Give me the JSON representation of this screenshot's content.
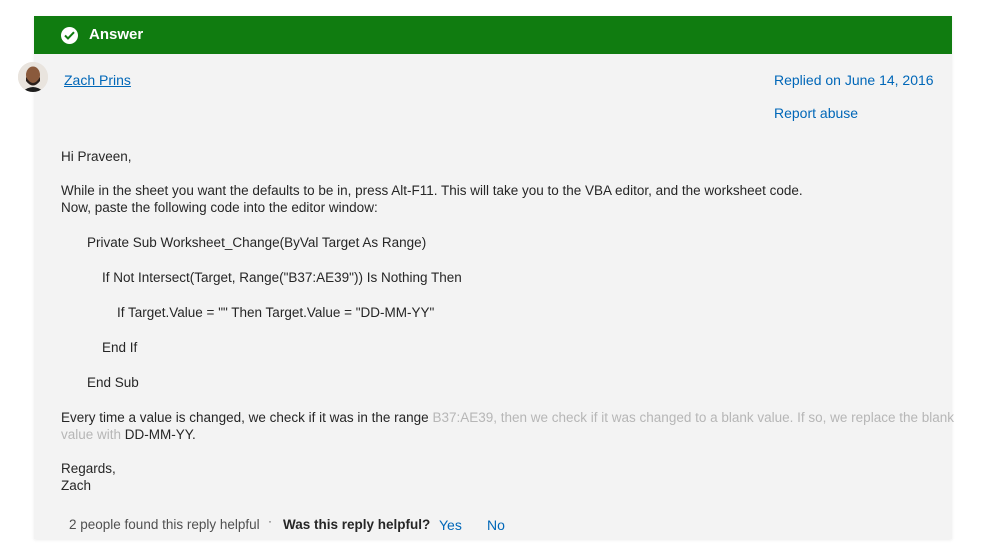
{
  "answer_header": {
    "label": "Answer",
    "icon": "check-circle-icon",
    "color": "#107c10"
  },
  "author": {
    "name": "Zach Prins",
    "avatar": "avatar-icon"
  },
  "meta": {
    "replied": "Replied on June 14, 2016",
    "report": "Report abuse"
  },
  "post": {
    "greeting": "Hi Praveen,",
    "intro_line1": "While in the sheet you want the defaults to be in, press Alt-F11. This will take you to the VBA editor, and the worksheet code.",
    "intro_line2": "Now, paste the following code into the editor window:",
    "code": [
      "Private Sub Worksheet_Change(ByVal Target As Range)",
      "If Not Intersect(Target, Range(\"B37:AE39\")) Is Nothing Then",
      "If Target.Value = \"\" Then Target.Value = \"DD-MM-YY\"",
      "End If",
      "End Sub"
    ],
    "explain_line1_a": "Every time a value is changed, we check if it was in the range ",
    "explain_line1_b": "B37:AE39, then we check if it was changed to a blank value. If so, we replace the blank",
    "explain_line2_a": "value with ",
    "explain_line2_b": "DD-MM-YY.",
    "closing1": "Regards,",
    "closing2": "Zach"
  },
  "footer": {
    "helpful_count": "2 people found this reply helpful",
    "separator": "·",
    "question": "Was this reply helpful?",
    "yes": "Yes",
    "no": "No"
  }
}
